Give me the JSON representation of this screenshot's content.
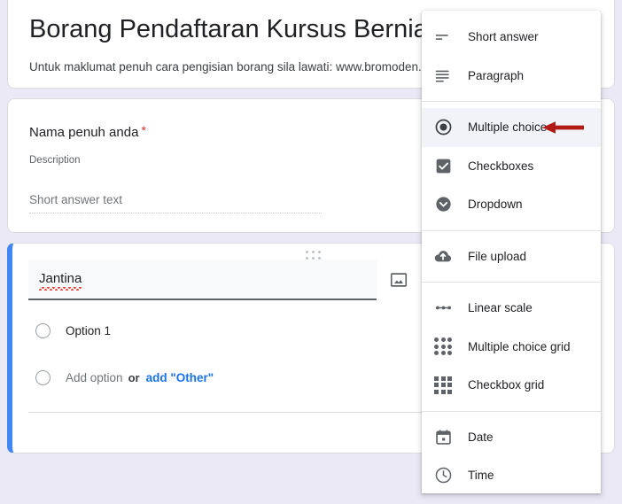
{
  "page": {
    "background_color": "#ebe9f5",
    "accent_color": "#4285f4",
    "link_color": "#1a73e8",
    "required_color": "#d93025",
    "annotation_color": "#b01b16"
  },
  "form": {
    "title": "Borang Pendaftaran Kursus Berniaga",
    "description": "Untuk maklumat penuh cara pengisian borang sila lawati: www.bromoden.com"
  },
  "questions": [
    {
      "title": "Nama penuh anda",
      "required_mark": "*",
      "description": "Description",
      "answer_placeholder": "Short answer text"
    },
    {
      "title": "Jantina",
      "options": [
        {
          "label": "Option 1"
        }
      ],
      "add_option_label": "Add option",
      "or_label": "or",
      "add_other_label": "add \"Other\""
    }
  ],
  "type_menu": {
    "groups": [
      {
        "items": [
          {
            "label": "Short answer",
            "icon": "short-answer-icon",
            "selected": false
          },
          {
            "label": "Paragraph",
            "icon": "paragraph-icon",
            "selected": false
          }
        ]
      },
      {
        "items": [
          {
            "label": "Multiple choice",
            "icon": "radio-button-icon",
            "selected": true
          },
          {
            "label": "Checkboxes",
            "icon": "checkbox-icon",
            "selected": false
          },
          {
            "label": "Dropdown",
            "icon": "dropdown-icon",
            "selected": false
          }
        ]
      },
      {
        "items": [
          {
            "label": "File upload",
            "icon": "cloud-upload-icon",
            "selected": false
          }
        ]
      },
      {
        "items": [
          {
            "label": "Linear scale",
            "icon": "linear-scale-icon",
            "selected": false
          },
          {
            "label": "Multiple choice grid",
            "icon": "radio-grid-icon",
            "selected": false
          },
          {
            "label": "Checkbox grid",
            "icon": "checkbox-grid-icon",
            "selected": false
          }
        ]
      },
      {
        "items": [
          {
            "label": "Date",
            "icon": "calendar-icon",
            "selected": false
          },
          {
            "label": "Time",
            "icon": "clock-icon",
            "selected": false
          }
        ]
      }
    ]
  }
}
